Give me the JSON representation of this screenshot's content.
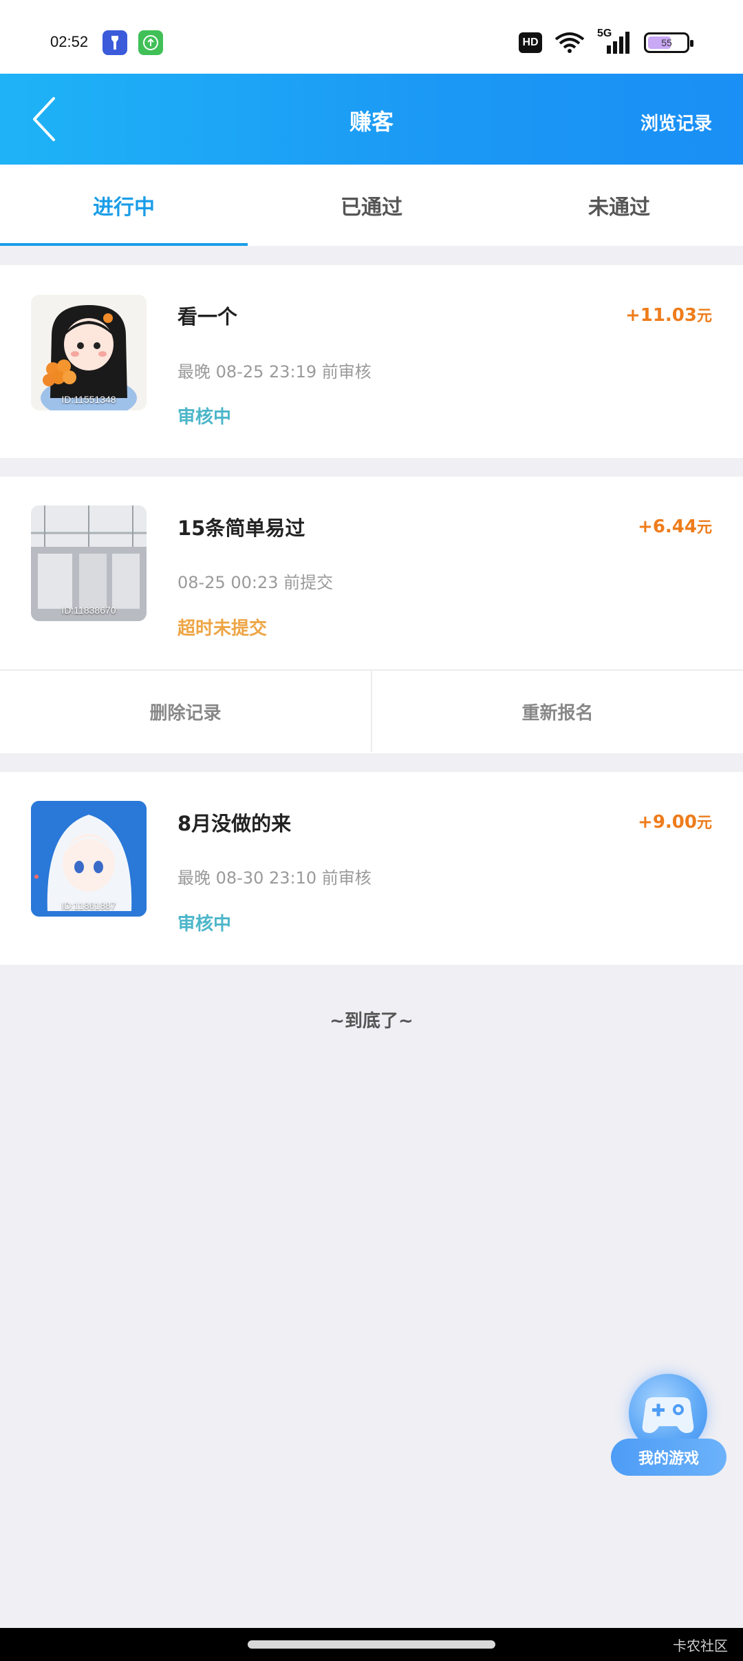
{
  "status_bar": {
    "time": "02:52",
    "network": "5G",
    "hd_badge": "HD",
    "battery": "55",
    "icons": [
      "flashlight-app-icon",
      "upload-app-icon",
      "wifi-icon",
      "signal-icon",
      "battery-icon"
    ]
  },
  "header": {
    "title": "赚客",
    "action_label": "浏览记录",
    "back_icon": "back-chevron-icon"
  },
  "tabs": [
    {
      "label": "进行中",
      "active": true
    },
    {
      "label": "已通过",
      "active": false
    },
    {
      "label": "未通过",
      "active": false
    }
  ],
  "tasks": [
    {
      "title": "看一个",
      "reward": "+11.03",
      "unit": "元",
      "meta": "最晚 08-25 23:19 前审核",
      "status": "审核中",
      "thumb_id": "ID:11551348"
    },
    {
      "title": "15条简单易过",
      "reward": "+6.44",
      "unit": "元",
      "meta": "08-25 00:23 前提交",
      "status": "超时未提交",
      "thumb_id": "ID:11838670",
      "actions": [
        "删除记录",
        "重新报名"
      ]
    },
    {
      "title": "8月没做的来",
      "reward": "+9.00",
      "unit": "元",
      "meta": "最晚 08-30 23:10 前审核",
      "status": "审核中",
      "thumb_id": "ID:11861887"
    }
  ],
  "end_text": "~到底了~",
  "fab": {
    "label": "我的游戏",
    "icon": "gamepad-icon"
  },
  "watermark": "卡农社区",
  "colors": {
    "header_start": "#1fb3f6",
    "header_end": "#1a8ff5",
    "tab_active": "#1a9de8",
    "reward": "#ee7c1b",
    "status_review": "#4cb6c9",
    "status_timeout": "#eda545",
    "page_bg": "#efeff4"
  }
}
